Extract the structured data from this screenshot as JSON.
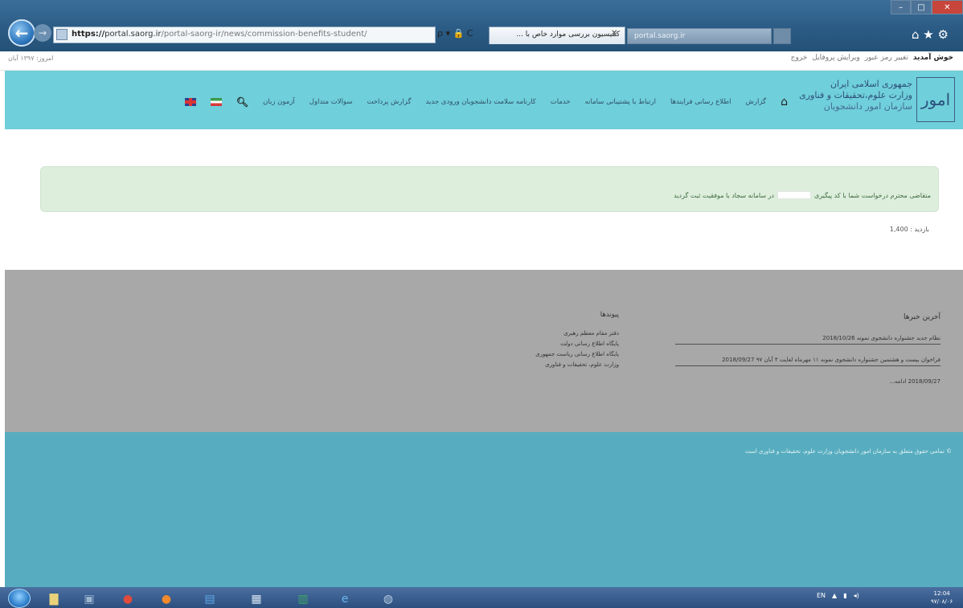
{
  "browser": {
    "url_scheme": "https://",
    "url_host": "portal.saorg.ir",
    "url_path": "/portal-saorg-ir/news/commission-benefits-student/",
    "address_tools": "ρ ▾ 🔒 C",
    "tab_active_title": "کمیسیون بررسی موارد خاص با ...",
    "tab_inactive_title": "portal.saorg.ir",
    "right_icons": "⌂ ★ ⚙"
  },
  "topbar": {
    "left_text": "امروز: ۱۳۹۷ آبان",
    "welcome": "خوش آمدید",
    "links": [
      "تغییر رمز عبور",
      "ویرایش پروفایل",
      "خروج"
    ]
  },
  "header": {
    "logo_text": "امور",
    "org_lines": [
      "جمهوری اسلامی ایران",
      "وزارت علوم،تحقیقات و فناوری",
      "سازمان امور دانشجویان"
    ],
    "nav": [
      "گزارش",
      "اطلاع رسانی فرایندها",
      "ارتباط با پشتیبانی سامانه",
      "خدمات",
      "کارنامه سلامت دانشجویان ورودی جدید",
      "گزارش پرداخت",
      "سوالات متداول",
      "آزمون زبان"
    ]
  },
  "content": {
    "alert_before": "متقاضی محترم درخواست شما با کد پیگیری",
    "alert_after": "در سامانه سجاد با موفقیت ثبت گردید",
    "views": "بازدید : 1,400"
  },
  "footer": {
    "news_title": "آخرین خبرها",
    "news": [
      "نظام جدید جشنواره دانشجوی نمونه 2018/10/26",
      "فراخوان بیست و هشتمین جشنواره دانشجوی نمونه ۱۱ مهرماه لغایت ۴ آبان ۹۷ 2018/09/27",
      "2018/09/27 ادامه..."
    ],
    "links_title": "پیوندها",
    "links": [
      "دفتر مقام معظم رهبری",
      "پایگاه اطلاع رسانی دولت",
      "پایگاه اطلاع رسانی ریاست جمهوری",
      "وزارت علوم، تحقیقات و فناوری"
    ],
    "copyright": "© تمامی حقوق متعلق به سازمان امور دانشجویان وزارت علوم، تحقیقات و فناوری است"
  },
  "taskbar": {
    "lang": "EN",
    "clock_time": "12:04",
    "clock_date": "۹۷/۰۸/۰۶"
  }
}
